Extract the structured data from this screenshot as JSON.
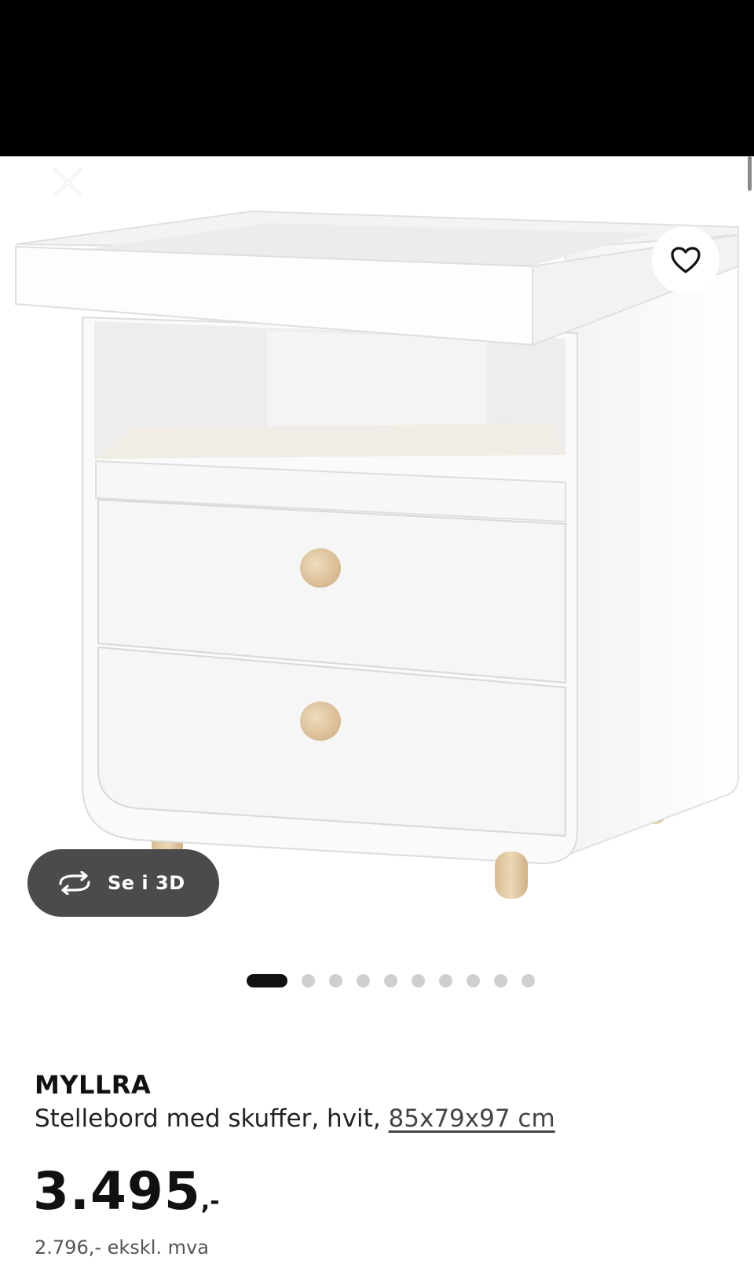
{
  "product": {
    "name": "MYLLRA",
    "description": "Stellebord med skuffer, hvit,",
    "dimensions": "85x79x97 cm",
    "price_amount": "3.495",
    "price_suffix": ",-",
    "price_ex_vat": "2.796,- ekskl. mva"
  },
  "gallery": {
    "view_3d_label": "Se i 3D",
    "image_count": 10,
    "active_index": 0
  },
  "icons": {
    "close": "close-icon",
    "favorite": "heart-icon",
    "rotate_3d": "rotate-3d-icon"
  },
  "colors": {
    "top_bar": "#000000",
    "button_dark": "#4b4b4b",
    "text_primary": "#111111",
    "dot_inactive": "#cfcfcf",
    "wood": "#e2cba8"
  }
}
